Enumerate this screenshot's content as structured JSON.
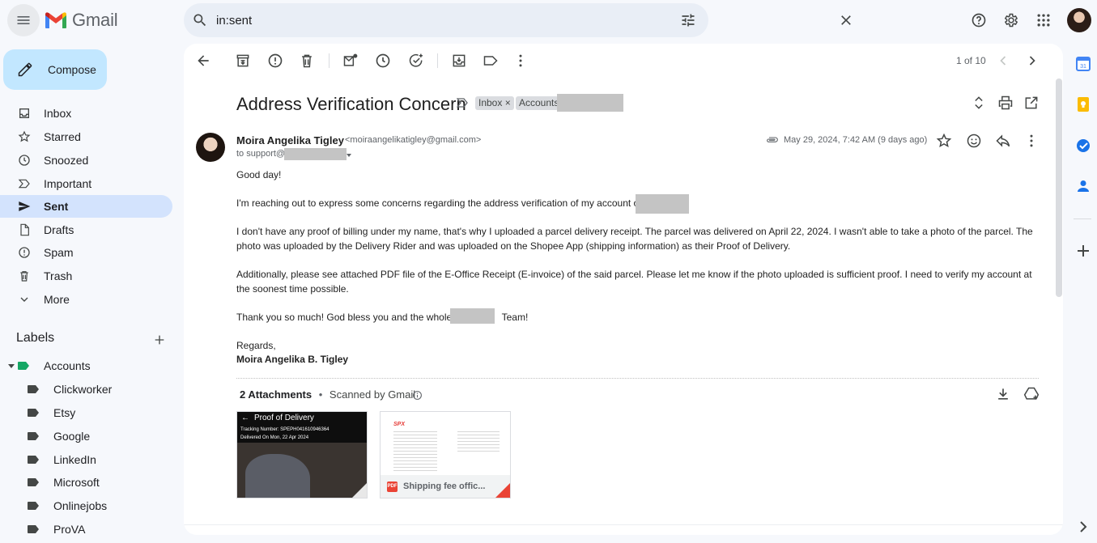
{
  "header": {
    "app_name": "Gmail",
    "search_value": "in:sent"
  },
  "sidebar": {
    "compose_label": "Compose",
    "items": [
      {
        "label": "Inbox"
      },
      {
        "label": "Starred"
      },
      {
        "label": "Snoozed"
      },
      {
        "label": "Important"
      },
      {
        "label": "Sent",
        "active": true
      },
      {
        "label": "Drafts"
      },
      {
        "label": "Spam"
      },
      {
        "label": "Trash"
      },
      {
        "label": "More"
      }
    ],
    "labels_title": "Labels",
    "labels": [
      {
        "label": "Accounts",
        "color": "#16a765"
      },
      {
        "label": "Clickworker"
      },
      {
        "label": "Etsy"
      },
      {
        "label": "Google"
      },
      {
        "label": "LinkedIn"
      },
      {
        "label": "Microsoft"
      },
      {
        "label": "Onlinejobs"
      },
      {
        "label": "ProVA"
      }
    ]
  },
  "toolbar": {
    "pager": "1 of 10"
  },
  "message": {
    "subject": "Address Verification Concern",
    "chips": {
      "inbox": "Inbox",
      "inbox_close": "×",
      "accounts": "Accounts"
    },
    "sender_name": "Moira Angelika Tigley",
    "sender_email": "<moiraangelikatigley@gmail.com>",
    "to_prefix": "to support@",
    "date": "May 29, 2024, 7:42 AM (9 days ago)",
    "body": {
      "greeting": "Good day!",
      "p1": "I'm reaching out to express some concerns regarding the address verification of my account on",
      "p2": "I don't have any proof of billing under my name, that's why I uploaded a parcel delivery receipt. The parcel was delivered on April 22, 2024. I wasn't able to take a photo of the parcel. The photo was uploaded by the Delivery Rider and was uploaded on the Shopee App (shipping information) as their Proof of Delivery.",
      "p3": "Additionally, please see attached PDF file of the E-Office Receipt (E-invoice) of the said parcel. Please let me know if the photo uploaded is sufficient proof.  I need to verify my account at the soonest time possible.",
      "p4_a": "Thank you so much! God bless you and the whole",
      "p4_b": "Team!",
      "closing": "Regards,",
      "signature": "Moira Angelika B. Tigley"
    }
  },
  "attachments": {
    "count_label": "2 Attachments",
    "dot": "•",
    "scanned": "Scanned by Gmail",
    "items": [
      {
        "title": "Proof of Delivery",
        "line1": "Tracking Number: SPEPH041610946364",
        "line2": "Delivered On Mon, 22 Apr 2024"
      },
      {
        "brand": "SPX",
        "pdf_badge": "PDF",
        "name": "Shipping fee offic..."
      }
    ]
  },
  "colors": {
    "compose_bg": "#c2e7ff",
    "active_nav_bg": "#d3e3fd",
    "panel_bg": "#ffffff",
    "page_bg": "#f6f8fc"
  }
}
